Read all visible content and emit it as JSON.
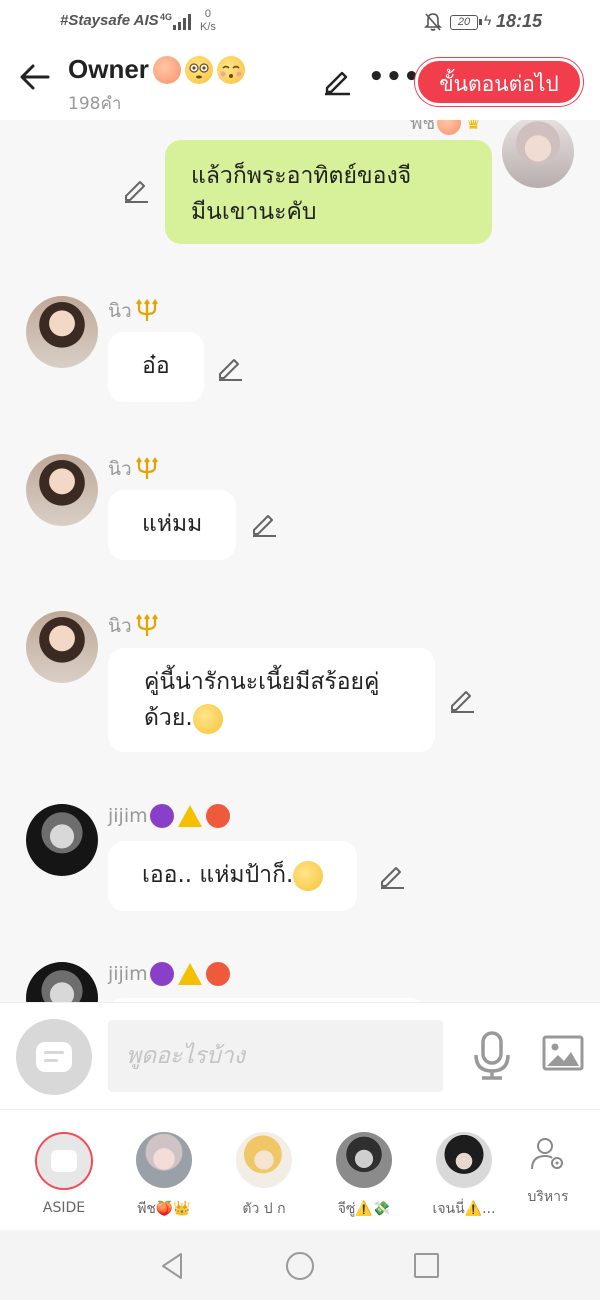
{
  "status_bar": {
    "carrier": "#Staysafe AIS",
    "network": "4G",
    "speed_value": "0",
    "speed_unit": "K/s",
    "battery": "20",
    "time": "18:15"
  },
  "header": {
    "title": "Owner",
    "title_emojis": [
      "peach-emoji",
      "flushed-face-emoji",
      "kissing-face-emoji"
    ],
    "word_count": "198คำ",
    "next_button": "ขั้นตอนต่อไป"
  },
  "messages": [
    {
      "sender": "พีช",
      "side": "right",
      "text": "แล้วก็พระอาทิตย์ของจีมีนเขานะคับ"
    },
    {
      "sender": "นิว",
      "side": "left",
      "text": "อ๋อ"
    },
    {
      "sender": "นิว",
      "side": "left",
      "text": "แห่มม"
    },
    {
      "sender": "นิว",
      "side": "left",
      "text": "คู่นี้น่ารักนะเนี้ยมีสร้อยคู่ด้วย."
    },
    {
      "sender": "jijim",
      "side": "left",
      "text": "เออ.. แห่มป้าก็."
    },
    {
      "sender": "jijim",
      "side": "left",
      "text": ""
    }
  ],
  "message_lines": {
    "m0_l1": "แล้วก็พระอาทิตย์ของจี",
    "m0_l2": "มีนเขานะคับ",
    "m3_l1": "คู่นี้น่ารักนะเนี้ยมีสร้อยคู่",
    "m3_l2": "ด้วย."
  },
  "input": {
    "placeholder": "พูดอะไรบ้าง"
  },
  "tabs": [
    {
      "label": "ASIDE"
    },
    {
      "label": "พีช🍑👑"
    },
    {
      "label": "ตัว ป ก"
    },
    {
      "label": "จีซู่⚠️💸"
    },
    {
      "label": "เจนนี่⚠️..."
    },
    {
      "label": "บริหาร"
    }
  ],
  "colors": {
    "accent": "#f23d4c",
    "my_bubble": "#d7f09a",
    "other_bubble": "#ffffff",
    "chat_bg": "#f7f7f7"
  }
}
